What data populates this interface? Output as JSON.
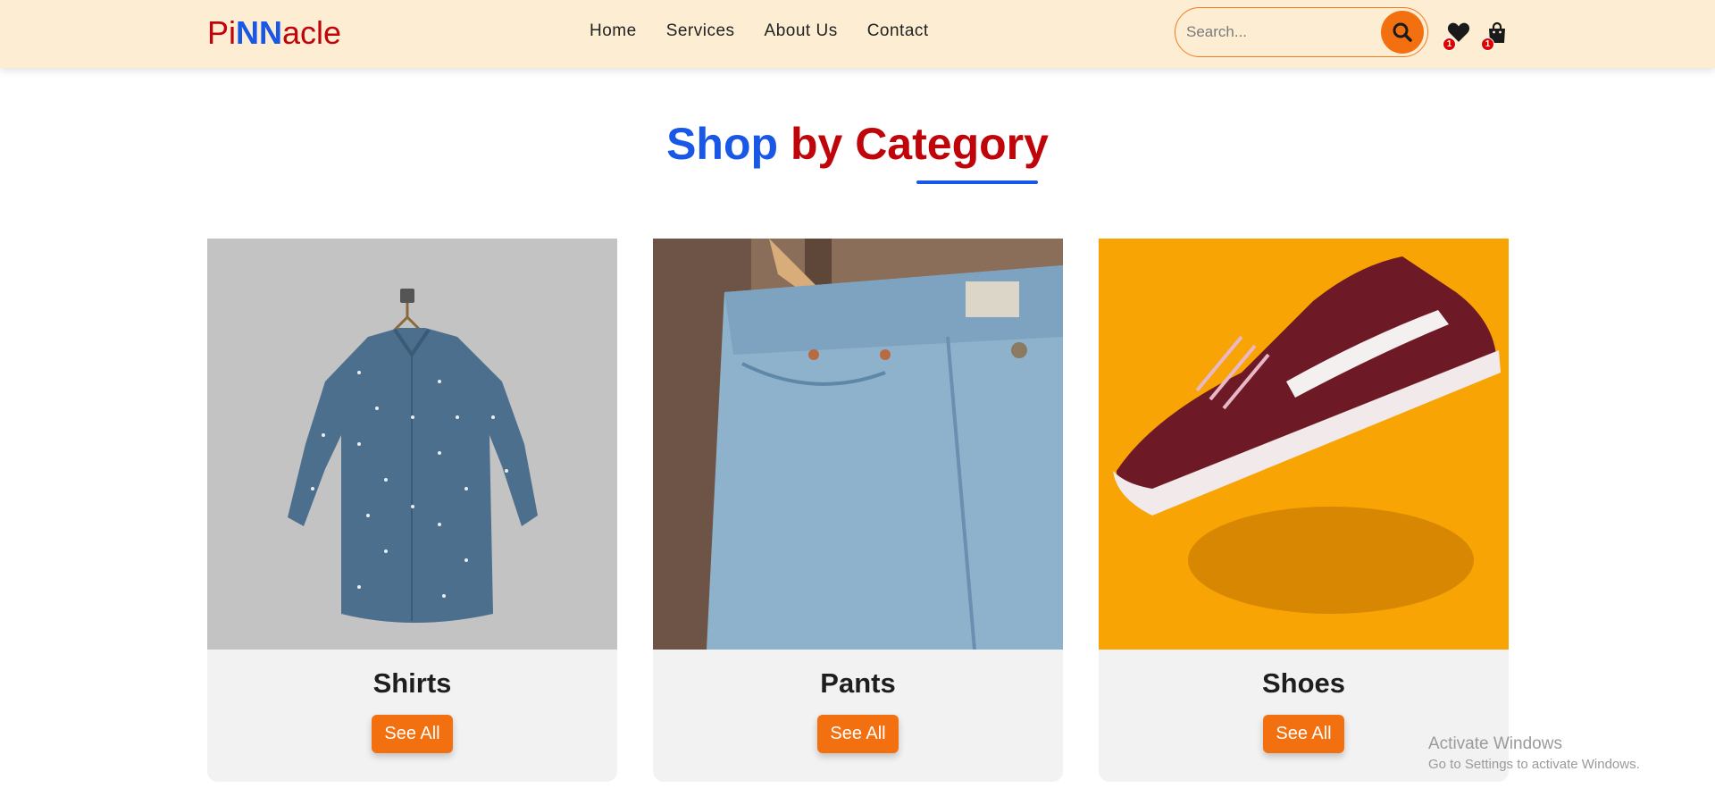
{
  "header": {
    "logo": {
      "part1": "Pi",
      "part2": "NN",
      "part3": "acle"
    },
    "nav": [
      {
        "label": "Home"
      },
      {
        "label": "Services"
      },
      {
        "label": "About Us"
      },
      {
        "label": "Contact"
      }
    ],
    "search": {
      "placeholder": "Search...",
      "icon": "search-icon"
    },
    "wishlist": {
      "icon": "heart-icon",
      "count": "1"
    },
    "cart": {
      "icon": "shopping-bag-icon",
      "count": "1"
    }
  },
  "section": {
    "title_part1": "Shop",
    "title_part2": "by Category"
  },
  "categories": [
    {
      "name": "Shirts",
      "button": "See All",
      "image": "chambray-shirt-on-hanger"
    },
    {
      "name": "Pants",
      "button": "See All",
      "image": "denim-jeans-on-hanger"
    },
    {
      "name": "Shoes",
      "button": "See All",
      "image": "maroon-sneaker-on-yellow"
    }
  ],
  "watermark": {
    "title": "Activate Windows",
    "subtitle": "Go to Settings to activate Windows."
  },
  "colors": {
    "accent": "#f37010",
    "brand_blue": "#1957e6",
    "brand_red": "#c0050a",
    "header_bg": "#fdedd3"
  }
}
